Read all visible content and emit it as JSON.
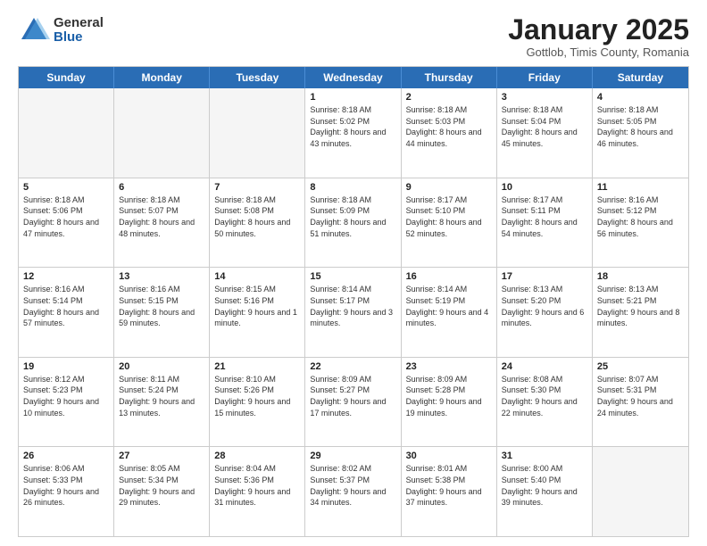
{
  "logo": {
    "general": "General",
    "blue": "Blue"
  },
  "header": {
    "month": "January 2025",
    "location": "Gottlob, Timis County, Romania"
  },
  "weekdays": [
    "Sunday",
    "Monday",
    "Tuesday",
    "Wednesday",
    "Thursday",
    "Friday",
    "Saturday"
  ],
  "weeks": [
    [
      {
        "day": "",
        "empty": true
      },
      {
        "day": "",
        "empty": true
      },
      {
        "day": "",
        "empty": true
      },
      {
        "day": "1",
        "sunrise": "8:18 AM",
        "sunset": "5:02 PM",
        "daylight": "8 hours and 43 minutes."
      },
      {
        "day": "2",
        "sunrise": "8:18 AM",
        "sunset": "5:03 PM",
        "daylight": "8 hours and 44 minutes."
      },
      {
        "day": "3",
        "sunrise": "8:18 AM",
        "sunset": "5:04 PM",
        "daylight": "8 hours and 45 minutes."
      },
      {
        "day": "4",
        "sunrise": "8:18 AM",
        "sunset": "5:05 PM",
        "daylight": "8 hours and 46 minutes."
      }
    ],
    [
      {
        "day": "5",
        "sunrise": "8:18 AM",
        "sunset": "5:06 PM",
        "daylight": "8 hours and 47 minutes."
      },
      {
        "day": "6",
        "sunrise": "8:18 AM",
        "sunset": "5:07 PM",
        "daylight": "8 hours and 48 minutes."
      },
      {
        "day": "7",
        "sunrise": "8:18 AM",
        "sunset": "5:08 PM",
        "daylight": "8 hours and 50 minutes."
      },
      {
        "day": "8",
        "sunrise": "8:18 AM",
        "sunset": "5:09 PM",
        "daylight": "8 hours and 51 minutes."
      },
      {
        "day": "9",
        "sunrise": "8:17 AM",
        "sunset": "5:10 PM",
        "daylight": "8 hours and 52 minutes."
      },
      {
        "day": "10",
        "sunrise": "8:17 AM",
        "sunset": "5:11 PM",
        "daylight": "8 hours and 54 minutes."
      },
      {
        "day": "11",
        "sunrise": "8:16 AM",
        "sunset": "5:12 PM",
        "daylight": "8 hours and 56 minutes."
      }
    ],
    [
      {
        "day": "12",
        "sunrise": "8:16 AM",
        "sunset": "5:14 PM",
        "daylight": "8 hours and 57 minutes."
      },
      {
        "day": "13",
        "sunrise": "8:16 AM",
        "sunset": "5:15 PM",
        "daylight": "8 hours and 59 minutes."
      },
      {
        "day": "14",
        "sunrise": "8:15 AM",
        "sunset": "5:16 PM",
        "daylight": "9 hours and 1 minute."
      },
      {
        "day": "15",
        "sunrise": "8:14 AM",
        "sunset": "5:17 PM",
        "daylight": "9 hours and 3 minutes."
      },
      {
        "day": "16",
        "sunrise": "8:14 AM",
        "sunset": "5:19 PM",
        "daylight": "9 hours and 4 minutes."
      },
      {
        "day": "17",
        "sunrise": "8:13 AM",
        "sunset": "5:20 PM",
        "daylight": "9 hours and 6 minutes."
      },
      {
        "day": "18",
        "sunrise": "8:13 AM",
        "sunset": "5:21 PM",
        "daylight": "9 hours and 8 minutes."
      }
    ],
    [
      {
        "day": "19",
        "sunrise": "8:12 AM",
        "sunset": "5:23 PM",
        "daylight": "9 hours and 10 minutes."
      },
      {
        "day": "20",
        "sunrise": "8:11 AM",
        "sunset": "5:24 PM",
        "daylight": "9 hours and 13 minutes."
      },
      {
        "day": "21",
        "sunrise": "8:10 AM",
        "sunset": "5:26 PM",
        "daylight": "9 hours and 15 minutes."
      },
      {
        "day": "22",
        "sunrise": "8:09 AM",
        "sunset": "5:27 PM",
        "daylight": "9 hours and 17 minutes."
      },
      {
        "day": "23",
        "sunrise": "8:09 AM",
        "sunset": "5:28 PM",
        "daylight": "9 hours and 19 minutes."
      },
      {
        "day": "24",
        "sunrise": "8:08 AM",
        "sunset": "5:30 PM",
        "daylight": "9 hours and 22 minutes."
      },
      {
        "day": "25",
        "sunrise": "8:07 AM",
        "sunset": "5:31 PM",
        "daylight": "9 hours and 24 minutes."
      }
    ],
    [
      {
        "day": "26",
        "sunrise": "8:06 AM",
        "sunset": "5:33 PM",
        "daylight": "9 hours and 26 minutes."
      },
      {
        "day": "27",
        "sunrise": "8:05 AM",
        "sunset": "5:34 PM",
        "daylight": "9 hours and 29 minutes."
      },
      {
        "day": "28",
        "sunrise": "8:04 AM",
        "sunset": "5:36 PM",
        "daylight": "9 hours and 31 minutes."
      },
      {
        "day": "29",
        "sunrise": "8:02 AM",
        "sunset": "5:37 PM",
        "daylight": "9 hours and 34 minutes."
      },
      {
        "day": "30",
        "sunrise": "8:01 AM",
        "sunset": "5:38 PM",
        "daylight": "9 hours and 37 minutes."
      },
      {
        "day": "31",
        "sunrise": "8:00 AM",
        "sunset": "5:40 PM",
        "daylight": "9 hours and 39 minutes."
      },
      {
        "day": "",
        "empty": true
      }
    ]
  ]
}
